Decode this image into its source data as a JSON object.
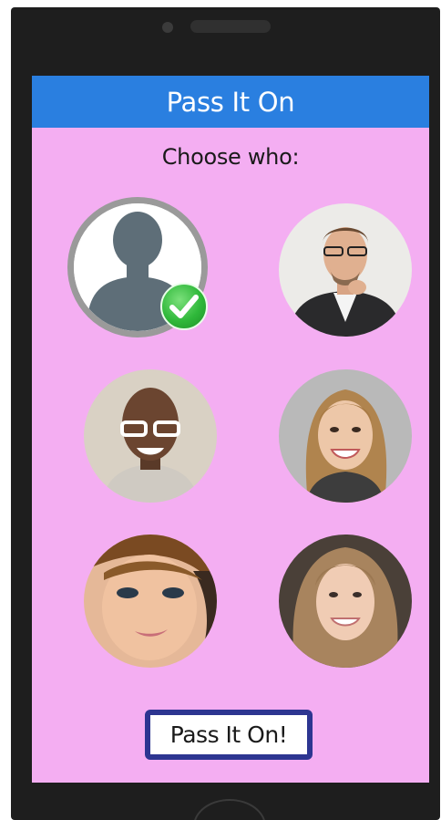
{
  "header": {
    "title": "Pass It On"
  },
  "prompt": "Choose who:",
  "contacts": [
    {
      "id": "default-avatar",
      "selected": true,
      "icon": "person-silhouette-icon"
    },
    {
      "id": "man-glasses-suit",
      "selected": false
    },
    {
      "id": "man-white-glasses",
      "selected": false
    },
    {
      "id": "woman-smiling-blonde",
      "selected": false
    },
    {
      "id": "woman-selfie",
      "selected": false
    },
    {
      "id": "woman-long-hair",
      "selected": false
    }
  ],
  "selection_icon": "checkmark-icon",
  "action_button": {
    "label": "Pass It On!"
  },
  "colors": {
    "header": "#2a7fe0",
    "background": "#f4aef2",
    "button_border": "#2d3591",
    "check": "#2fb83a"
  }
}
